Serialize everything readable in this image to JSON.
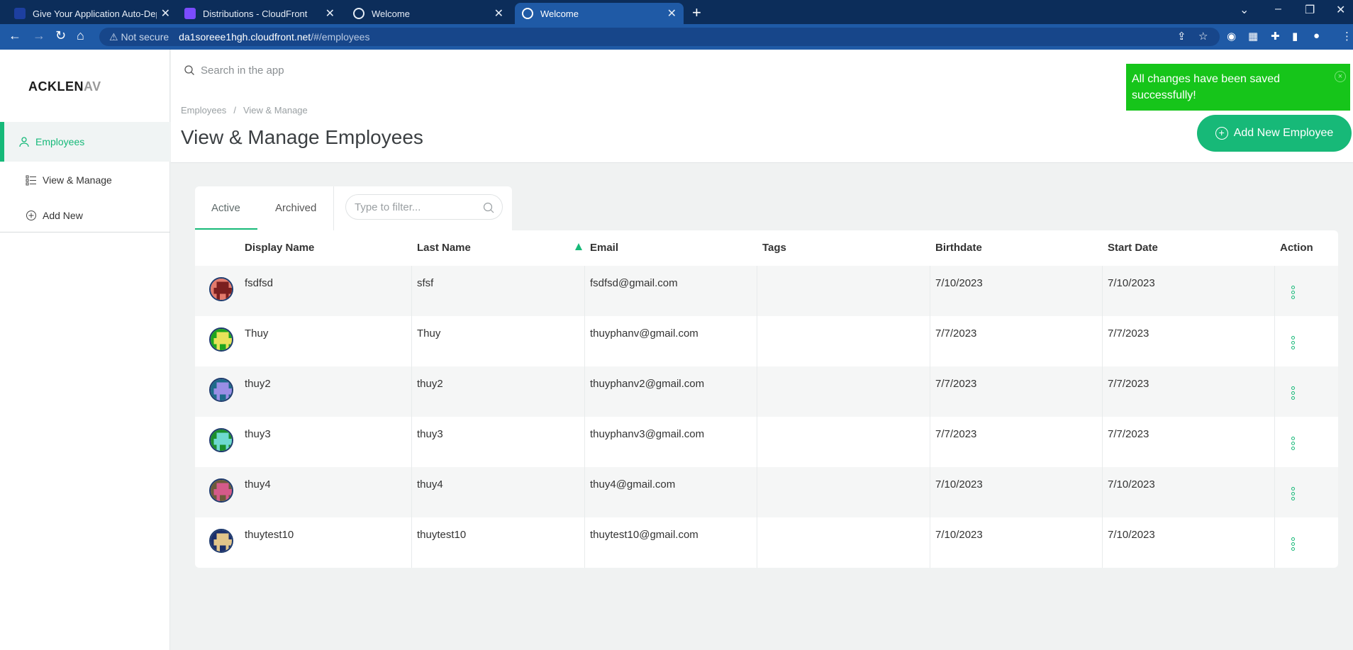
{
  "browser": {
    "tabs": [
      {
        "title": "Give Your Application Auto-Depl",
        "favicon_color": "#1d3fa0"
      },
      {
        "title": "Distributions - CloudFront",
        "favicon_color": "#7b4cff"
      },
      {
        "title": "Welcome",
        "favicon_color": "#e6edf6"
      },
      {
        "title": "Welcome",
        "favicon_color": "#e6edf6"
      }
    ],
    "security_label": "Not secure",
    "url_host": "da1soreee1hgh.cloudfront.net",
    "url_path": "/#/employees"
  },
  "app": {
    "logo_main": "ACKLEN",
    "logo_tail": "AV",
    "search_placeholder": "Search in the app"
  },
  "sidebar": {
    "items": [
      {
        "label": "Employees",
        "icon": "person-icon"
      },
      {
        "label": "View & Manage",
        "icon": "list-icon"
      },
      {
        "label": "Add New",
        "icon": "plus-circle-icon"
      }
    ]
  },
  "breadcrumb": {
    "root": "Employees",
    "sep": "/",
    "current": "View & Manage"
  },
  "page_title": "View & Manage Employees",
  "add_button_label": "Add New Employee",
  "toast": {
    "message": "All changes have been saved successfully!",
    "close": "×"
  },
  "filter_tabs": {
    "active": "Active",
    "archived": "Archived"
  },
  "filter_placeholder": "Type to filter...",
  "table": {
    "headers": {
      "display_name": "Display Name",
      "last_name": "Last Name",
      "email": "Email",
      "tags": "Tags",
      "birthdate": "Birthdate",
      "start_date": "Start Date",
      "action": "Action"
    },
    "rows": [
      {
        "display_name": "fsdfsd",
        "last_name": "sfsf",
        "email": "fsdfsd@gmail.com",
        "tags": "",
        "birthdate": "7/10/2023",
        "start_date": "7/10/2023",
        "avatar_bg": "#e27a6b",
        "avatar_fg": "#7a1f1f"
      },
      {
        "display_name": "Thuy",
        "last_name": "Thuy",
        "email": "thuyphanv@gmail.com",
        "tags": "",
        "birthdate": "7/7/2023",
        "start_date": "7/7/2023",
        "avatar_bg": "#1ea51e",
        "avatar_fg": "#e8e25a"
      },
      {
        "display_name": "thuy2",
        "last_name": "thuy2",
        "email": "thuyphanv2@gmail.com",
        "tags": "",
        "birthdate": "7/7/2023",
        "start_date": "7/7/2023",
        "avatar_bg": "#1d6a8a",
        "avatar_fg": "#9a8ee6"
      },
      {
        "display_name": "thuy3",
        "last_name": "thuy3",
        "email": "thuyphanv3@gmail.com",
        "tags": "",
        "birthdate": "7/7/2023",
        "start_date": "7/7/2023",
        "avatar_bg": "#1a8e2c",
        "avatar_fg": "#6ed9d0"
      },
      {
        "display_name": "thuy4",
        "last_name": "thuy4",
        "email": "thuy4@gmail.com",
        "tags": "",
        "birthdate": "7/10/2023",
        "start_date": "7/10/2023",
        "avatar_bg": "#6b5a3a",
        "avatar_fg": "#d45a8a"
      },
      {
        "display_name": "thuytest10",
        "last_name": "thuytest10",
        "email": "thuytest10@gmail.com",
        "tags": "",
        "birthdate": "7/10/2023",
        "start_date": "7/10/2023",
        "avatar_bg": "#1b2f6a",
        "avatar_fg": "#e2c58a"
      }
    ]
  }
}
